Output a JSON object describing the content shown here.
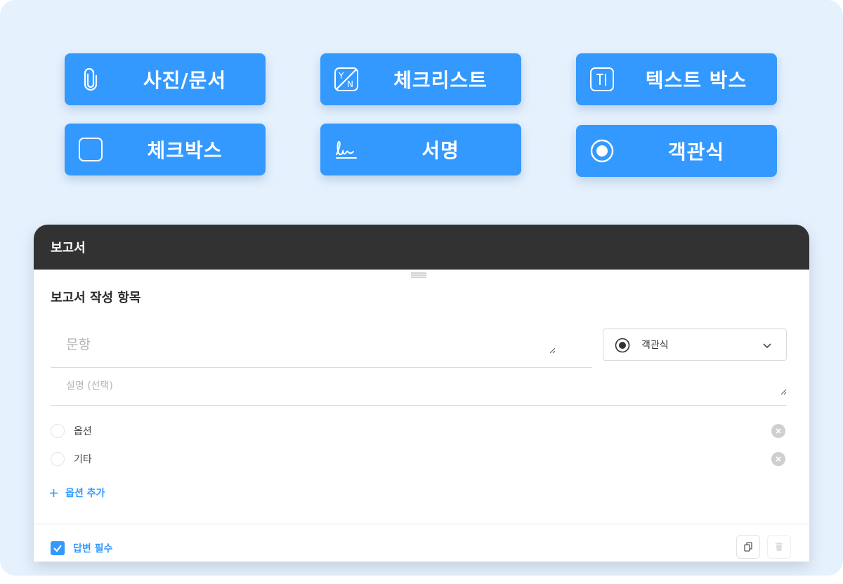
{
  "tools": [
    {
      "label": "사진/문서",
      "icon": "paperclip-icon"
    },
    {
      "label": "체크리스트",
      "icon": "checklist-yn-icon"
    },
    {
      "label": "텍스트 박스",
      "icon": "text-box-icon"
    },
    {
      "label": "체크박스",
      "icon": "checkbox-icon"
    },
    {
      "label": "서명",
      "icon": "signature-icon"
    },
    {
      "label": "객관식",
      "icon": "radio-icon"
    }
  ],
  "card": {
    "title": "보고서",
    "section_title": "보고서 작성 항목",
    "question_placeholder": "문항",
    "description_placeholder": "설명 (선택)",
    "type_select": {
      "selected": "객관식",
      "icon": "radio-icon"
    },
    "options": [
      "옵션",
      "기타"
    ],
    "add_option_label": "옵션 추가",
    "required_label": "답변 필수",
    "required_checked": true
  },
  "colors": {
    "accent": "#3399ff",
    "header_bg": "#323232",
    "page_bg": "#e5f1fd"
  }
}
